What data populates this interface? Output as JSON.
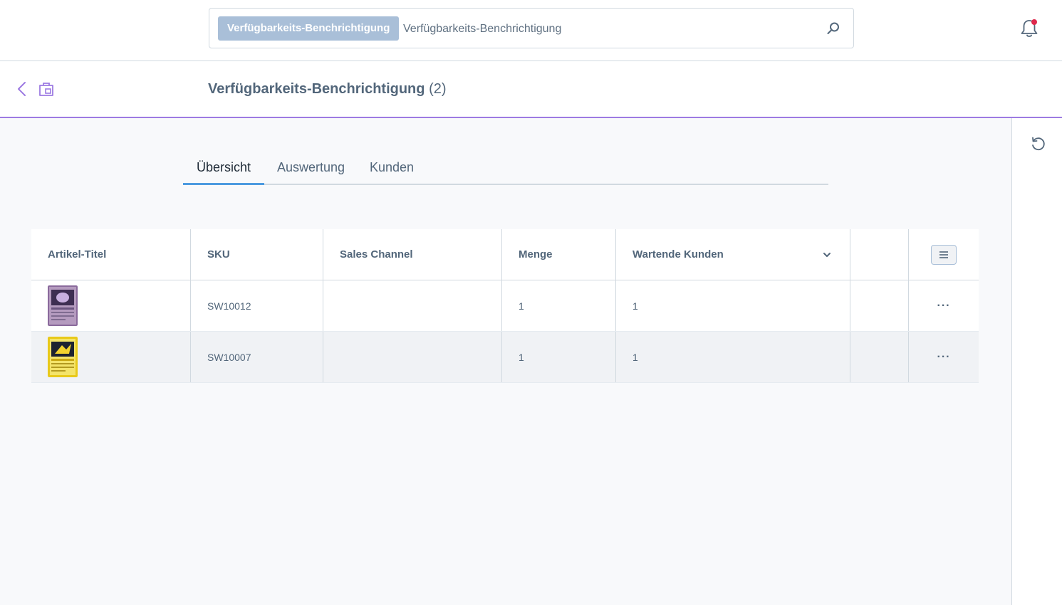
{
  "search": {
    "tag": "Verfügbarkeits-Benchrichtigung",
    "placeholder": "Verfügbarkeits-Benchrichtigung"
  },
  "header": {
    "title": "Verfügbarkeits-Benchrichtigung",
    "count": "(2)"
  },
  "tabs": [
    {
      "label": "Übersicht",
      "active": true
    },
    {
      "label": "Auswertung",
      "active": false
    },
    {
      "label": "Kunden",
      "active": false
    }
  ],
  "table": {
    "columns": {
      "title": "Artikel-Titel",
      "sku": "SKU",
      "sales_channel": "Sales Channel",
      "quantity": "Menge",
      "waiting": "Wartende Kunden"
    },
    "rows": [
      {
        "sku": "SW10012",
        "sales_channel": "",
        "quantity": "1",
        "waiting": "1",
        "actions": "···"
      },
      {
        "sku": "SW10007",
        "sales_channel": "",
        "quantity": "1",
        "waiting": "1",
        "actions": "···"
      }
    ]
  },
  "colors": {
    "accent": "#9d7be2",
    "tab_active": "#4d9be0",
    "tag_bg": "#a9bfd8",
    "notification_dot": "#de294c"
  }
}
